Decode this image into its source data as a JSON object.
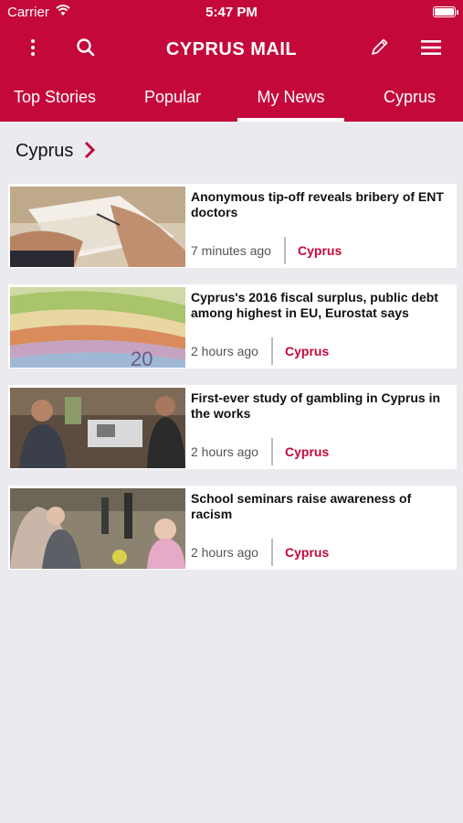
{
  "status_bar": {
    "carrier": "Carrier",
    "time": "5:47 PM"
  },
  "toolbar": {
    "app_name": "CYPRUS MAIL",
    "icons": [
      "more-vertical-icon",
      "search-icon",
      "pencil-icon",
      "menu-icon"
    ]
  },
  "tabs": [
    {
      "label": "Top Stories",
      "selected": false
    },
    {
      "label": "Popular",
      "selected": false
    },
    {
      "label": "My News",
      "selected": true
    },
    {
      "label": "Cyprus",
      "selected": false
    }
  ],
  "section": {
    "title": "Cyprus"
  },
  "articles": [
    {
      "title": "Anonymous tip-off reveals bribery of ENT doctors",
      "time": "7 minutes ago",
      "category": "Cyprus"
    },
    {
      "title": "Cyprus's 2016 fiscal surplus, public debt among highest in EU, Eurostat says",
      "time": "2 hours ago",
      "category": "Cyprus"
    },
    {
      "title": "First-ever study of gambling in Cyprus in the works",
      "time": "2 hours ago",
      "category": "Cyprus"
    },
    {
      "title": "School seminars raise awareness of racism",
      "time": "2 hours ago",
      "category": "Cyprus"
    }
  ],
  "colors": {
    "brand": "#c4093a",
    "background": "#ebebef"
  }
}
